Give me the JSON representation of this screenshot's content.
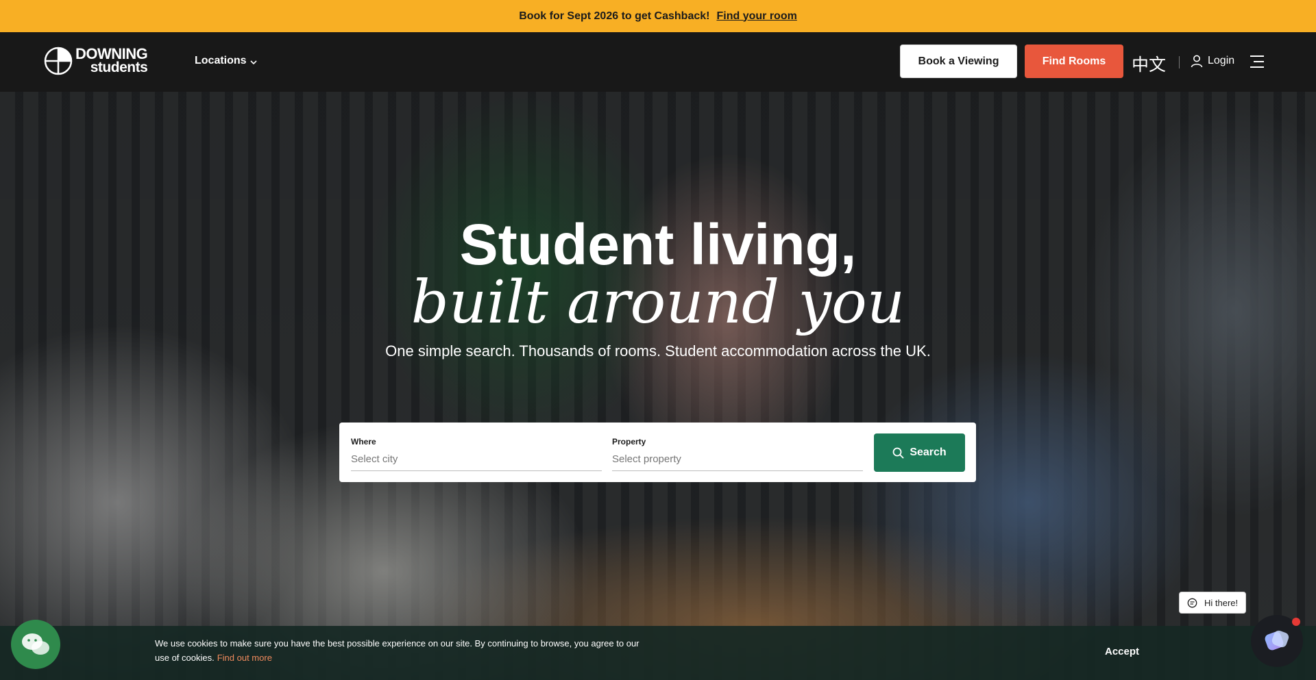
{
  "promo": {
    "text": "Book for Sept 2026 to get Cashback!",
    "link": "Find your room"
  },
  "nav": {
    "logo_line1": "DOWNING",
    "logo_line2": "students",
    "locations": "Locations",
    "book_viewing": "Book a Viewing",
    "find_rooms": "Find Rooms",
    "language": "中文",
    "login": "Login"
  },
  "hero": {
    "title_line1": "Student living,",
    "title_line2": "built around you",
    "subtitle": "One simple search. Thousands of rooms. Student accommodation across the UK."
  },
  "search": {
    "where_label": "Where",
    "where_placeholder": "Select city",
    "property_label": "Property",
    "property_placeholder": "Select property",
    "button": "Search"
  },
  "cookie": {
    "text": "We use cookies to make sure you have the best possible experience on our site. By continuing to browse, you agree to our use of cookies.",
    "link": "Find out more",
    "accept": "Accept"
  },
  "chat": {
    "greeting": "Hi there!"
  },
  "colors": {
    "promo_bg": "#f8af24",
    "nav_bg": "#181818",
    "find_rooms_bg": "#e8573c",
    "search_bg": "#1c7a58",
    "cookie_link": "#f08a5d",
    "wechat_bg": "#2f8a4c"
  }
}
